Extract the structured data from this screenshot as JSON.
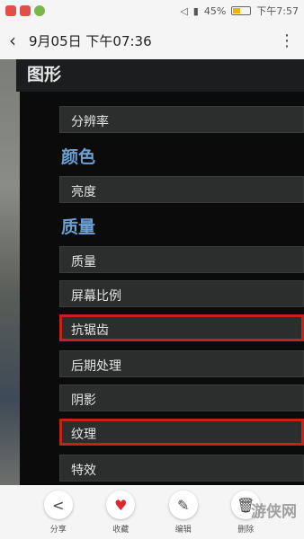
{
  "status_bar": {
    "battery": "45%",
    "time": "下午7:57",
    "battery_level": 0.45
  },
  "header": {
    "title": "9月05日 下午07:36"
  },
  "screen": {
    "section_title": "图形",
    "categories": {
      "color": "颜色",
      "quality": "质量"
    },
    "rows": {
      "resolution": "分辨率",
      "brightness": "亮度",
      "quality": "质量",
      "aspect_ratio": "屏幕比例",
      "antialiasing": "抗锯齿",
      "post_processing": "后期处理",
      "shadow": "阴影",
      "texture": "纹理",
      "effects": "特效"
    }
  },
  "actions": {
    "share": "分享",
    "favorite": "收藏",
    "edit": "编辑",
    "delete": "删除"
  },
  "watermark": "游侠网",
  "colors": {
    "highlight": "#c4221b",
    "category": "#6aa0d4"
  },
  "icons": [
    "back-icon",
    "more-icon",
    "share-icon",
    "heart-icon",
    "edit-icon",
    "delete-icon"
  ]
}
